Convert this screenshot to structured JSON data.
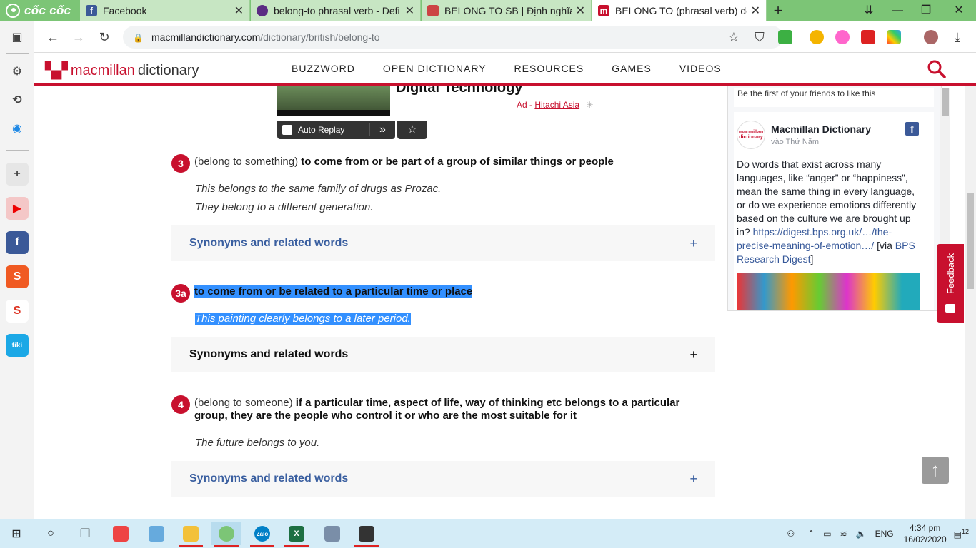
{
  "browser": {
    "brand": "cốc cốc",
    "tabs": [
      {
        "title": "Facebook",
        "icon": "facebook-icon",
        "color": "#3b5998"
      },
      {
        "title": "belong-to phrasal verb - Defi",
        "icon": "oxford-icon",
        "color": "#5b2c83"
      },
      {
        "title": "BELONG TO SB | Định nghĩa tr",
        "icon": "cambridge-icon",
        "color": "#c44"
      },
      {
        "title": "BELONG TO (phrasal verb) de",
        "icon": "macmillan-icon",
        "color": "#c8102e"
      }
    ],
    "active_tab": 3,
    "url_domain": "macmillandictionary.com",
    "url_path": "/dictionary/british/belong-to"
  },
  "site": {
    "logo_brand": "macmillan",
    "logo_word": "dictionary",
    "nav": [
      "BUZZWORD",
      "OPEN DICTIONARY",
      "RESOURCES",
      "GAMES",
      "VIDEOS"
    ]
  },
  "ad": {
    "title": "Digital Technology",
    "ad_label": "Ad -",
    "advertiser": "Hitachi Asia",
    "auto_replay": "Auto Replay"
  },
  "entries": [
    {
      "num": "3",
      "grammar": "(belong to something)",
      "definition": "to come from or be part of a group of similar things or people",
      "examples": [
        "This belongs to the same family of drugs as Prozac.",
        "They belong to a different generation."
      ],
      "synonyms": "Synonyms and related words"
    },
    {
      "num": "3a",
      "grammar": "",
      "definition": "to come from or be related to a particular time or place",
      "examples": [
        "This painting clearly belongs to a later period."
      ],
      "synonyms": "Synonyms and related words"
    },
    {
      "num": "4",
      "grammar": "(belong to someone)",
      "definition": "if a particular time, aspect of life, way of thinking etc belongs to a particular group, they are the people who control it or who are the most suitable for it",
      "examples": [
        "The future belongs to you."
      ],
      "synonyms": "Synonyms and related words"
    }
  ],
  "fb_widget": {
    "friends_text": "Be the first of your friends to like this",
    "page_name": "Macmillan Dictionary",
    "post_date": "vào Thứ Năm",
    "post_text": "Do words that exist across many languages, like “anger” or “happiness”, mean the same thing in every language, or do we experience emotions differently based on the culture we are brought up in? ",
    "post_link": "https://digest.bps.org.uk/…/the-precise-meaning-of-emotion…/",
    "post_via": " [via ",
    "post_via_link": "BPS Research Digest",
    "post_end": "]",
    "avatar_text": "macmillan dictionary"
  },
  "feedback_label": "Feedback",
  "taskbar": {
    "language": "ENG",
    "time": "4:34 pm",
    "date": "16/02/2020",
    "notifications": "12"
  }
}
